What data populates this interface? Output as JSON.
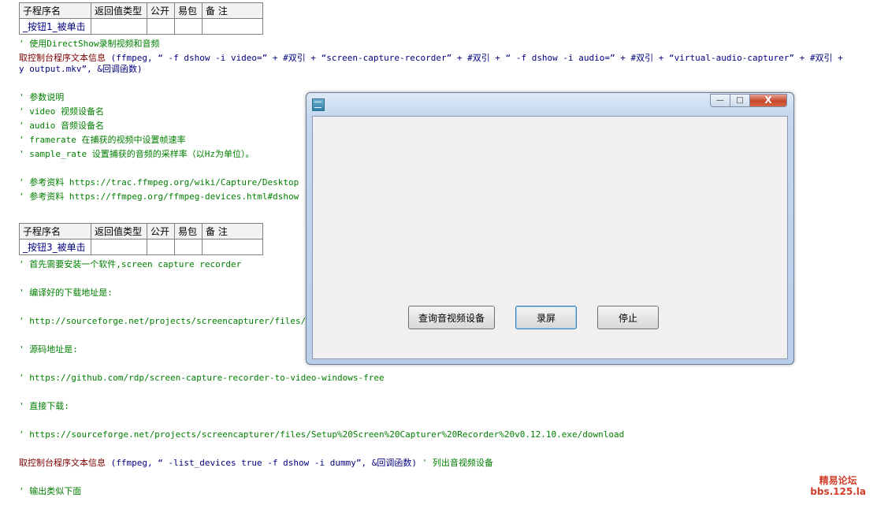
{
  "table1": {
    "headers": [
      "子程序名",
      "返回值类型",
      "公开",
      "易包",
      "备 注"
    ],
    "name": "_按钮1_被单击"
  },
  "code1": {
    "comment1": "' 使用DirectShow录制视频和音频",
    "cmd": "取控制台程序文本信息",
    "args_line1": " (ffmpeg, “ -f dshow -i video=” + #双引 + “screen-capture-recorder” + #双引 + “ -f dshow -i audio=” + #双引 + “virtual-audio-capturer” + #双引 +",
    "args_line2": "y output.mkv”, &回调函数)",
    "notes": [
      "' 参数说明",
      "' video 视频设备名",
      "' audio 音频设备名",
      "' framerate 在捕获的视频中设置帧速率",
      "' sample_rate 设置捕获的音频的采样率（以Hz为单位）。"
    ],
    "refs": [
      "' 参考资料 https://trac.ffmpeg.org/wiki/Capture/Desktop",
      "' 参考资料 https://ffmpeg.org/ffmpeg-devices.html#dshow"
    ]
  },
  "table2": {
    "headers": [
      "子程序名",
      "返回值类型",
      "公开",
      "易包",
      "备 注"
    ],
    "name": "_按钮3_被单击"
  },
  "code2": {
    "lines": [
      "' 首先需要安装一个软件,screen capture recorder",
      "' 编译好的下载地址是:",
      "' http://sourceforge.net/projects/screencapturer/files/",
      "' 源码地址是:",
      "' https://github.com/rdp/screen-capture-recorder-to-video-windows-free",
      "' 直接下载:",
      "' https://sourceforge.net/projects/screencapturer/files/Setup%20Screen%20Capturer%20Recorder%20v0.12.10.exe/download"
    ],
    "cmd": "取控制台程序文本信息",
    "args": " (ffmpeg, “ -list_devices true -f dshow -i dummy”, &回调函数)",
    "tail_comment": " ' 列出音视频设备",
    "last": "' 输出类似下面"
  },
  "window": {
    "controls": {
      "minimize": "—",
      "maximize": "□",
      "close": "X"
    },
    "buttons": {
      "query": "查询音视频设备",
      "record": "录屏",
      "stop": "停止"
    }
  },
  "watermark": {
    "line1": "精易论坛",
    "line2": "bbs.125.la"
  }
}
